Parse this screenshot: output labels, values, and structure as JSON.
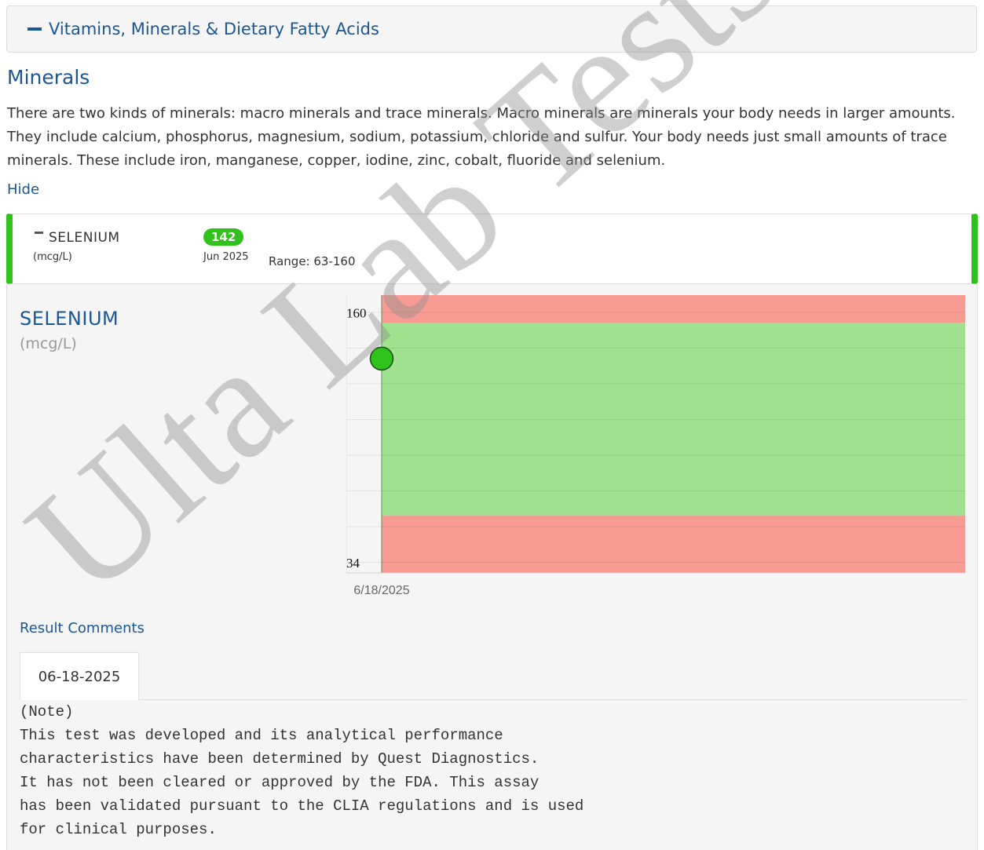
{
  "accordion": {
    "title": "Vitamins, Minerals & Dietary Fatty Acids"
  },
  "section": {
    "title": "Minerals",
    "description": "There are two kinds of minerals: macro minerals and trace minerals. Macro minerals are minerals your body needs in larger amounts. They include calcium, phosphorus, magnesium, sodium, potassium, chloride and sulfur. Your body needs just small amounts of trace minerals. These include iron, manganese, copper, iodine, zinc, cobalt, fluoride and selenium.",
    "hide_label": "Hide"
  },
  "result": {
    "name": "SELENIUM",
    "unit": "(mcg/L)",
    "value": "142",
    "date": "Jun 2025",
    "range": "Range: 63-160",
    "status_color": "#2ec21a"
  },
  "detail": {
    "title": "SELENIUM",
    "unit": "(mcg/L)"
  },
  "chart_data": {
    "type": "scatter",
    "x": [
      "6/18/2025"
    ],
    "y": [
      142
    ],
    "ylim": [
      34,
      174
    ],
    "y_tick_labels": [
      "160",
      "34"
    ],
    "bands": [
      {
        "from": 160,
        "to": 174,
        "color": "#f89c93"
      },
      {
        "from": 63,
        "to": 160,
        "color": "#a0e290"
      },
      {
        "from": 34,
        "to": 63,
        "color": "#f89c93"
      }
    ],
    "point_color": "#2ec21a",
    "grid": true
  },
  "comments": {
    "title": "Result Comments",
    "tab_label": "06-18-2025",
    "lines": [
      "(Note)",
      "This test was developed and its analytical performance",
      "characteristics have been determined by Quest Diagnostics.",
      "It has not been cleared or approved by the FDA. This assay",
      "has been validated pursuant to the CLIA regulations and is used",
      "for clinical purposes."
    ]
  },
  "watermark": "Ulta Lab Tests",
  "colors": {
    "brand": "#1a5796",
    "normal": "#2ec21a"
  }
}
